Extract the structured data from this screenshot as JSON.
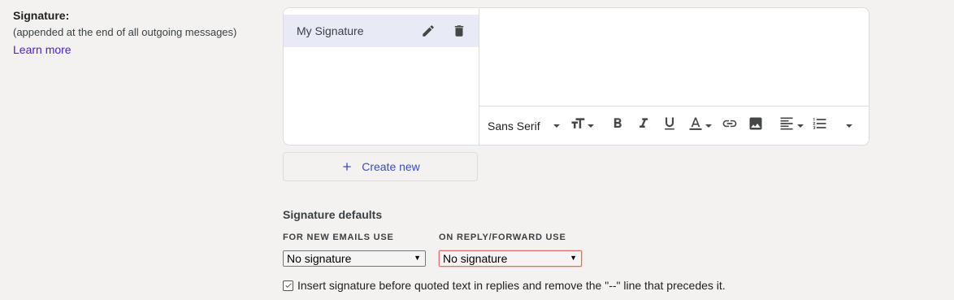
{
  "signature_section": {
    "title": "Signature:",
    "description": "(appended at the end of all outgoing messages)",
    "learn_more": "Learn more"
  },
  "signature_list": {
    "items": [
      {
        "label": "My Signature",
        "selected": true
      }
    ]
  },
  "editor_toolbar": {
    "font_family": "Sans Serif",
    "buttons": [
      "font-size-icon",
      "bold-icon",
      "italic-icon",
      "underline-icon",
      "text-color-icon",
      "link-icon",
      "image-icon",
      "align-icon",
      "numbered-list-icon",
      "more-formatting-icon"
    ]
  },
  "create_new": {
    "label": "Create new"
  },
  "signature_defaults": {
    "title": "Signature defaults",
    "new_emails": {
      "label": "FOR NEW EMAILS USE",
      "selected": "No signature"
    },
    "reply_forward": {
      "label": "ON REPLY/FORWARD USE",
      "selected": "No signature"
    }
  },
  "insert_option": {
    "checked": true,
    "label": "Insert signature before quoted text in replies and remove the \"--\" line that precedes it."
  },
  "colors": {
    "accent": "#3b4cc0",
    "link": "#4a20c7",
    "selected_row": "#e8eaf6",
    "focus_outline": "#e86c5a"
  }
}
